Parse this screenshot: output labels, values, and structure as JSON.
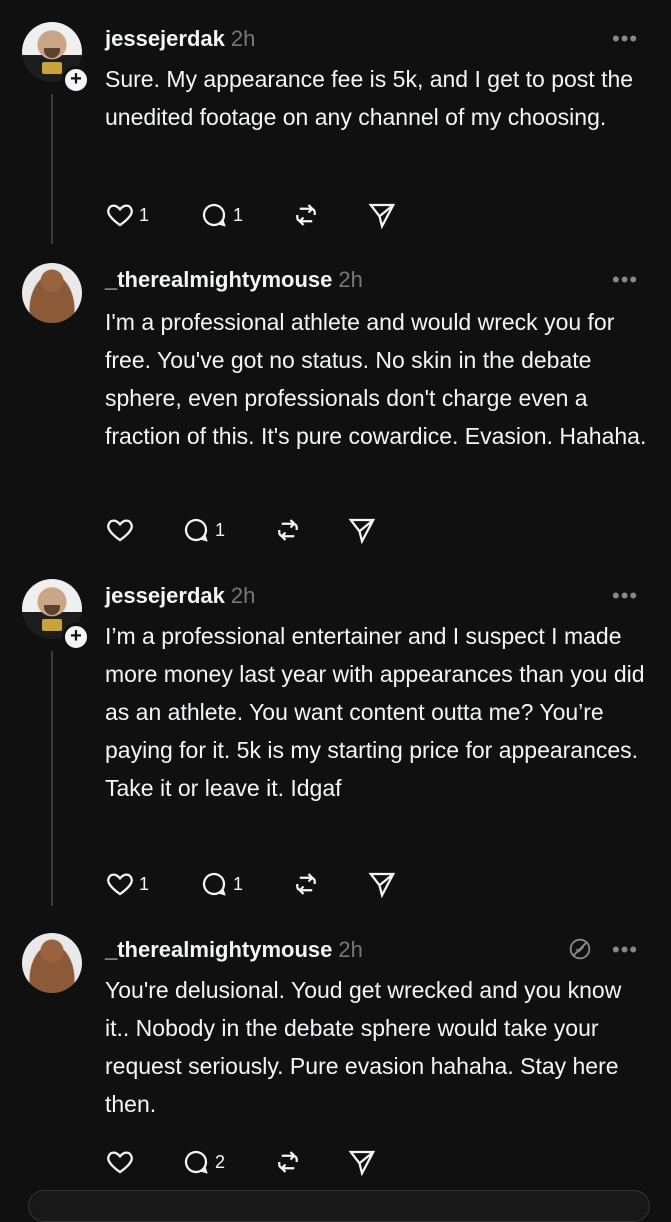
{
  "posts": [
    {
      "username": "jessejerdak",
      "time": "2h",
      "text": "Sure.  My appearance fee is 5k, and I get to post the unedited footage on any channel of my choosing.",
      "likes": "1",
      "replies": "1",
      "has_follow_badge": true
    },
    {
      "username": "_therealmightymouse",
      "time": "2h",
      "text": "I'm a professional athlete and would wreck you for free. You've got no status.  No skin in the debate sphere, even professionals don't charge even a fraction of this. It's pure cowardice. Evasion. Hahaha.",
      "likes": "",
      "replies": "1",
      "has_follow_badge": false
    },
    {
      "username": "jessejerdak",
      "time": "2h",
      "text": "I’m a professional entertainer and I suspect I made more money last year with appearances than you did as an athlete.  You want content outta me? You’re paying for it.  5k is my starting price for appearances.  Take it or leave it.  Idgaf",
      "likes": "1",
      "replies": "1",
      "has_follow_badge": true
    },
    {
      "username": "_therealmightymouse",
      "time": "2h",
      "text": "You're delusional. Youd get wrecked and you know it.. Nobody in the debate sphere would take your request seriously. Pure evasion hahaha. Stay here then.",
      "likes": "",
      "replies": "2",
      "has_follow_badge": false
    }
  ],
  "more_label": "•••",
  "follow_badge": "+",
  "icons": {
    "like": "heart-icon",
    "reply": "comment-icon",
    "repost": "repost-icon",
    "share": "send-icon",
    "mute": "mute-icon",
    "more": "more-icon"
  }
}
